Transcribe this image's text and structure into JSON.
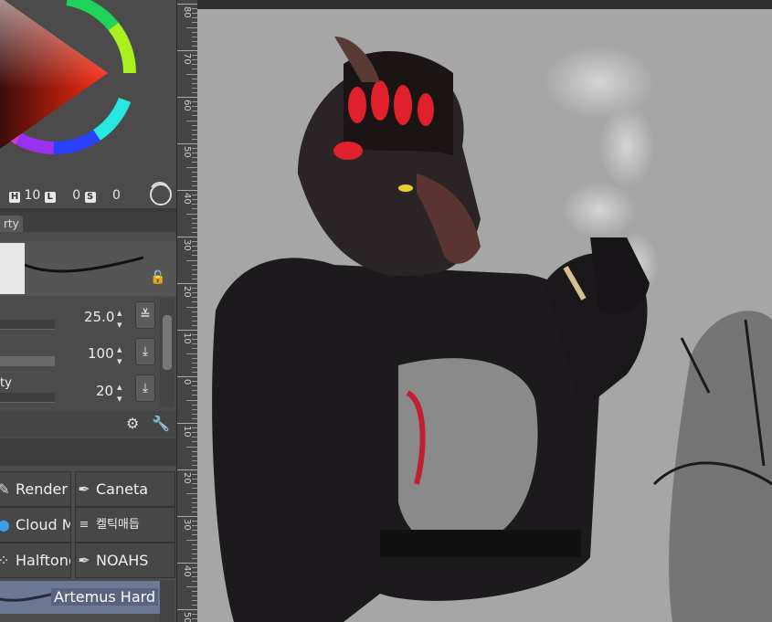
{
  "color_panel": {
    "h_label": "H",
    "h_value": "10",
    "l_label": "L",
    "s_value": "0",
    "s_label": "S",
    "v_value": "0"
  },
  "tool_property_tab": {
    "label": "rty"
  },
  "sliders": [
    {
      "label": "",
      "value": "25.0"
    },
    {
      "label": "",
      "value": "100"
    },
    {
      "label": "ty",
      "value": "20"
    }
  ],
  "brushes": [
    {
      "label": "Render",
      "icon": "brush-icon"
    },
    {
      "label": "Caneta",
      "icon": "pen-nib-icon"
    },
    {
      "label": "Cloud M",
      "icon": "cloud-icon"
    },
    {
      "label": "켈틱매듭",
      "icon": "lines-icon"
    },
    {
      "label": "Halftone",
      "icon": "dots-icon"
    },
    {
      "label": "NOAHS",
      "icon": "pen-nib-icon"
    }
  ],
  "selected_brush": {
    "label": "Artemus Hard"
  },
  "ruler_labels": [
    "80",
    "70",
    "60",
    "50",
    "40",
    "30",
    "20",
    "10",
    "0",
    "10",
    "20",
    "30",
    "40",
    "50"
  ],
  "colors": {
    "accent_red": "#e0202c",
    "canvas_bg": "#a6a6a6",
    "panel_bg": "#4b4b4b"
  }
}
